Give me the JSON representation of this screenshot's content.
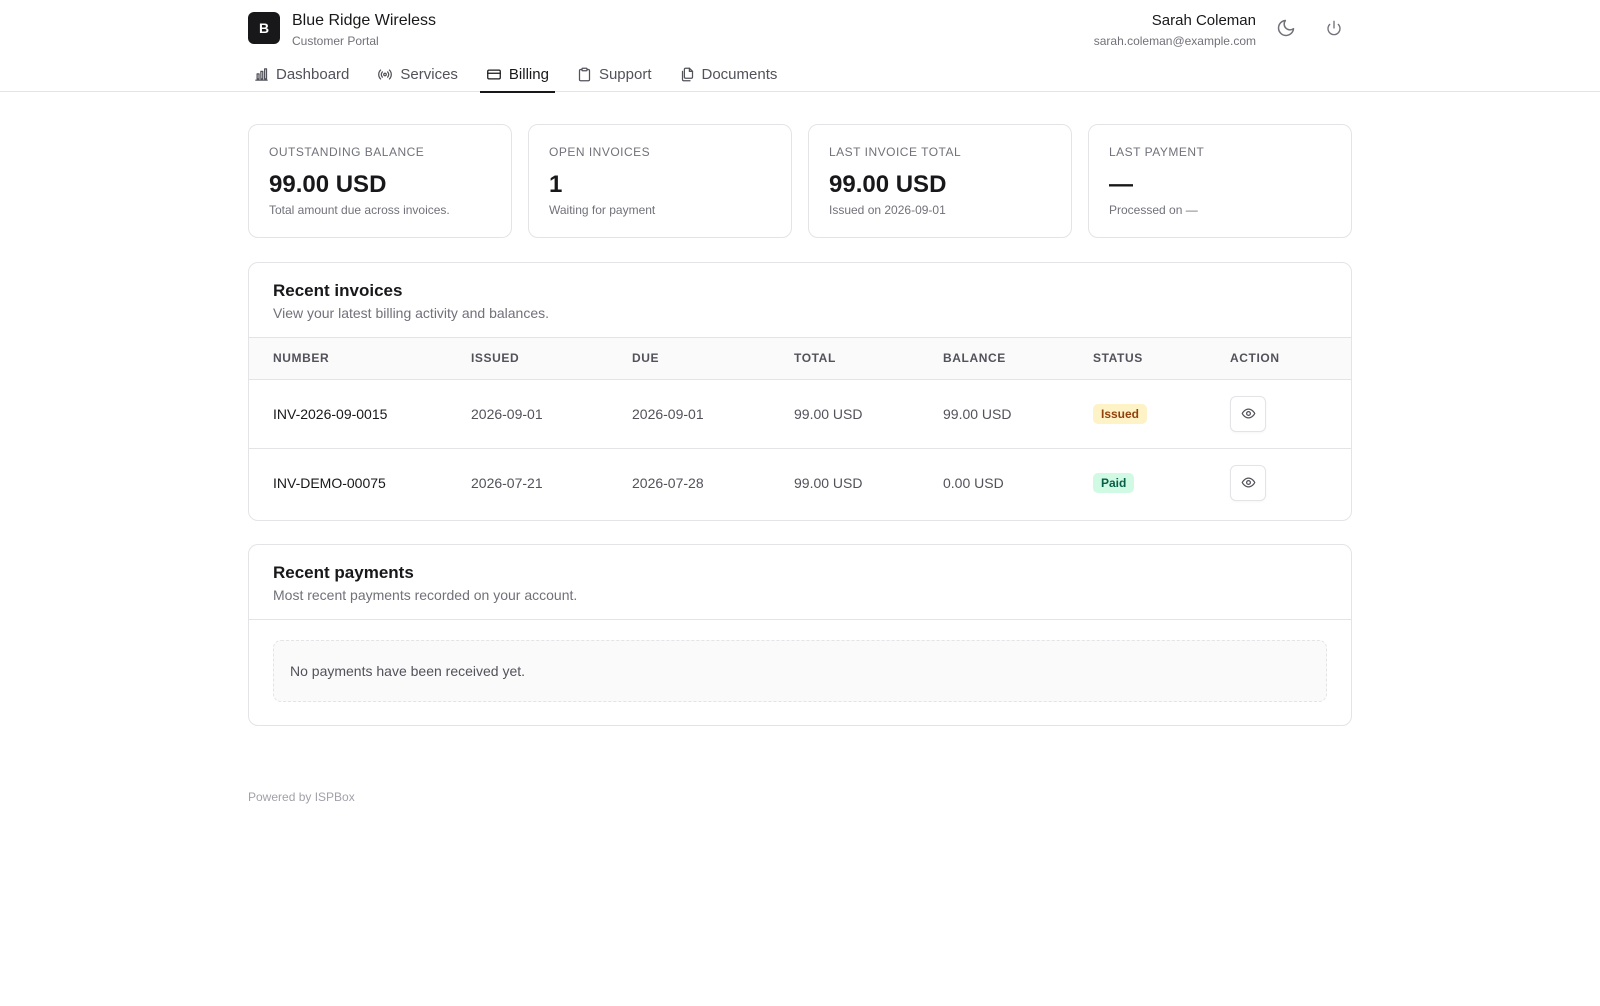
{
  "brand": {
    "logo_letter": "B",
    "name": "Blue Ridge Wireless",
    "subtitle": "Customer Portal"
  },
  "user": {
    "name": "Sarah Coleman",
    "email": "sarah.coleman@example.com"
  },
  "icons": {
    "theme": "moon-icon",
    "logout": "power-icon",
    "view": "eye-icon"
  },
  "nav": [
    {
      "label": "Dashboard",
      "icon": "bar-chart-icon",
      "active": false
    },
    {
      "label": "Services",
      "icon": "signal-icon",
      "active": false
    },
    {
      "label": "Billing",
      "icon": "credit-card-icon",
      "active": true
    },
    {
      "label": "Support",
      "icon": "clipboard-icon",
      "active": false
    },
    {
      "label": "Documents",
      "icon": "files-icon",
      "active": false
    }
  ],
  "stats": [
    {
      "label": "Outstanding balance",
      "value": "99.00 USD",
      "note": "Total amount due across invoices."
    },
    {
      "label": "Open invoices",
      "value": "1",
      "note": "Waiting for payment"
    },
    {
      "label": "Last invoice total",
      "value": "99.00 USD",
      "note": "Issued on 2026-09-01"
    },
    {
      "label": "Last payment",
      "value": "—",
      "note": "Processed on —"
    }
  ],
  "invoices": {
    "title": "Recent invoices",
    "description": "View your latest billing activity and balances.",
    "columns": [
      "Number",
      "Issued",
      "Due",
      "Total",
      "Balance",
      "Status",
      "Action"
    ],
    "rows": [
      {
        "number": "INV-2026-09-0015",
        "issued": "2026-09-01",
        "due": "2026-09-01",
        "total": "99.00 USD",
        "balance": "99.00 USD",
        "status": "Issued"
      },
      {
        "number": "INV-DEMO-00075",
        "issued": "2026-07-21",
        "due": "2026-07-28",
        "total": "99.00 USD",
        "balance": "0.00 USD",
        "status": "Paid"
      }
    ]
  },
  "payments": {
    "title": "Recent payments",
    "description": "Most recent payments recorded on your account.",
    "empty_text": "No payments have been received yet."
  },
  "footer": {
    "text": "Powered by ISPBox"
  },
  "colors": {
    "accent": "#18181b",
    "issued_bg": "#fef3c7",
    "issued_fg": "#92400e",
    "paid_bg": "#d1fae5",
    "paid_fg": "#065f46"
  }
}
